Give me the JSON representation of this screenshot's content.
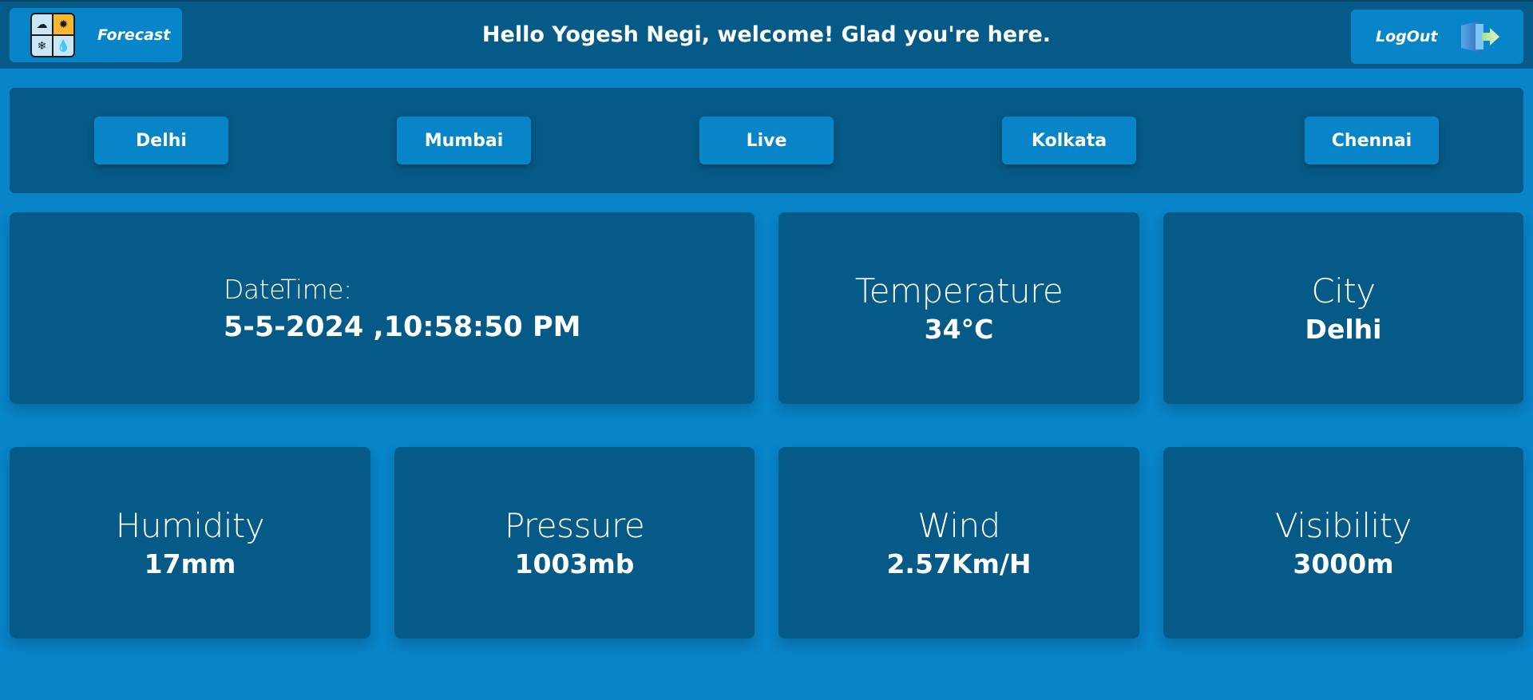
{
  "header": {
    "brand_label": "Forecast",
    "greeting": "Hello Yogesh Negi, welcome! Glad you're here.",
    "logout_label": "LogOut"
  },
  "cities": [
    "Delhi",
    "Mumbai",
    "Live",
    "Kolkata",
    "Chennai"
  ],
  "cards": {
    "datetime": {
      "label": "DateTime:",
      "value": "5-5-2024 ,10:58:50 PM"
    },
    "temperature": {
      "label": "Temperature",
      "value": "34°C"
    },
    "city": {
      "label": "City",
      "value": "Delhi"
    },
    "humidity": {
      "label": "Humidity",
      "value": "17mm"
    },
    "pressure": {
      "label": "Pressure",
      "value": "1003mb"
    },
    "wind": {
      "label": "Wind",
      "value": "2.57Km/H"
    },
    "visibility": {
      "label": "Visibility",
      "value": "3000m"
    }
  },
  "colors": {
    "background": "#0884c8",
    "panel": "#065a87"
  },
  "icons": {
    "brand": "weather-forecast-icon",
    "logout": "logout-door-icon"
  }
}
